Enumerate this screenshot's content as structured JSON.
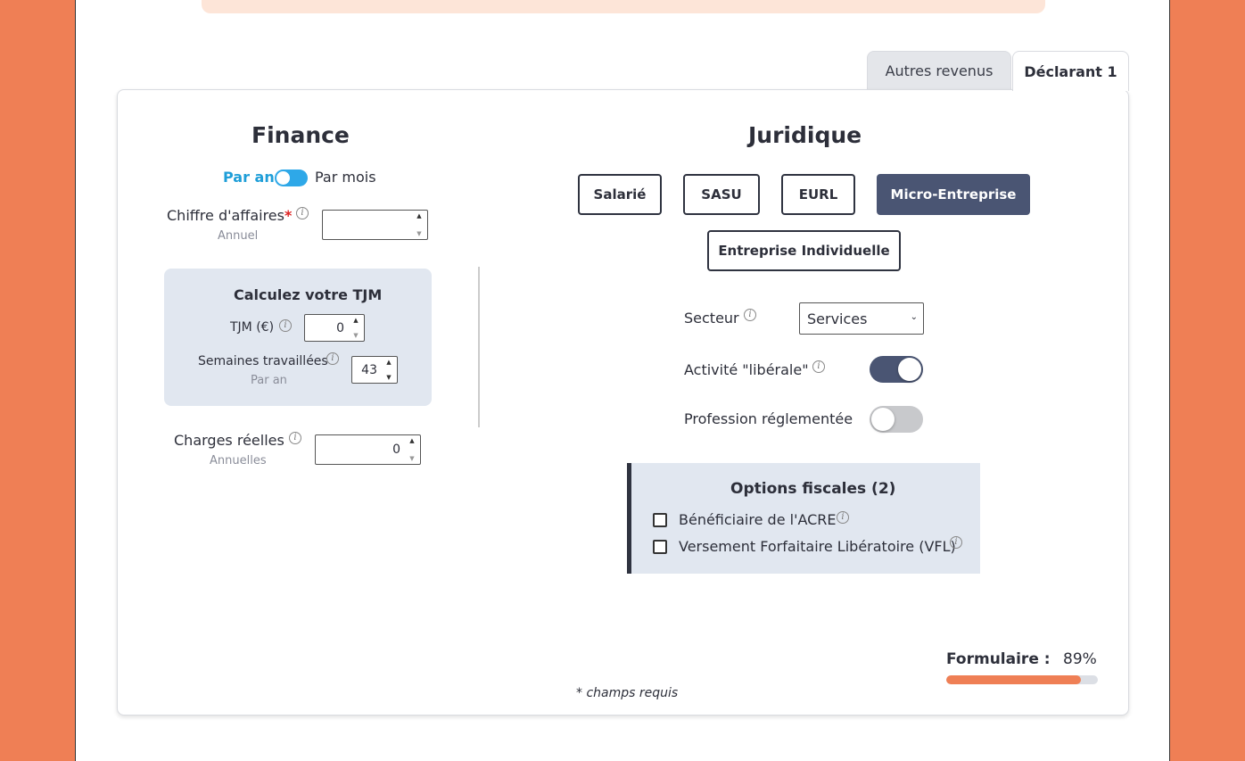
{
  "tabs": {
    "other": "Autres revenus",
    "active": "Déclarant 1"
  },
  "finance": {
    "title": "Finance",
    "period_year": "Par an",
    "period_month": "Par mois",
    "ca_label": "Chiffre d'affaires",
    "required_mark": "*",
    "ca_sub": "Annuel",
    "ca_value": "",
    "tjm_box_title": "Calculez votre TJM",
    "tjm_label": "TJM (€)",
    "tjm_value": "0",
    "weeks_label": "Semaines travaillées",
    "weeks_sub": "Par an",
    "weeks_value": "43",
    "charges_label": "Charges réelles",
    "charges_sub": "Annuelles",
    "charges_value": "0"
  },
  "juridique": {
    "title": "Juridique",
    "buttons": [
      "Salarié",
      "SASU",
      "EURL",
      "Micro-Entreprise",
      "Entreprise Individuelle"
    ],
    "active_button": "Micro-Entreprise",
    "secteur_label": "Secteur",
    "secteur_value": "Services",
    "liberale_label": "Activité \"libérale\"",
    "liberale_on": true,
    "reglementee_label": "Profession réglementée",
    "reglementee_on": false,
    "options_title": "Options fiscales (2)",
    "options": [
      "Bénéficiaire de l'ACRE",
      "Versement Forfaitaire Libératoire (VFL)"
    ]
  },
  "footer": {
    "required_note": "* champs requis",
    "form_label": "Formulaire :",
    "form_percent": "89%",
    "progress": 0.89
  },
  "colors": {
    "accent": "#ef7f55",
    "active_button": "#4a5573",
    "toggle_blue": "#2ea8e8",
    "box_bg": "#e1e7f0"
  },
  "icons": {
    "info": "info-circle-icon",
    "spin": "spinner-arrows-icon",
    "select": "chevron-down-icon"
  }
}
